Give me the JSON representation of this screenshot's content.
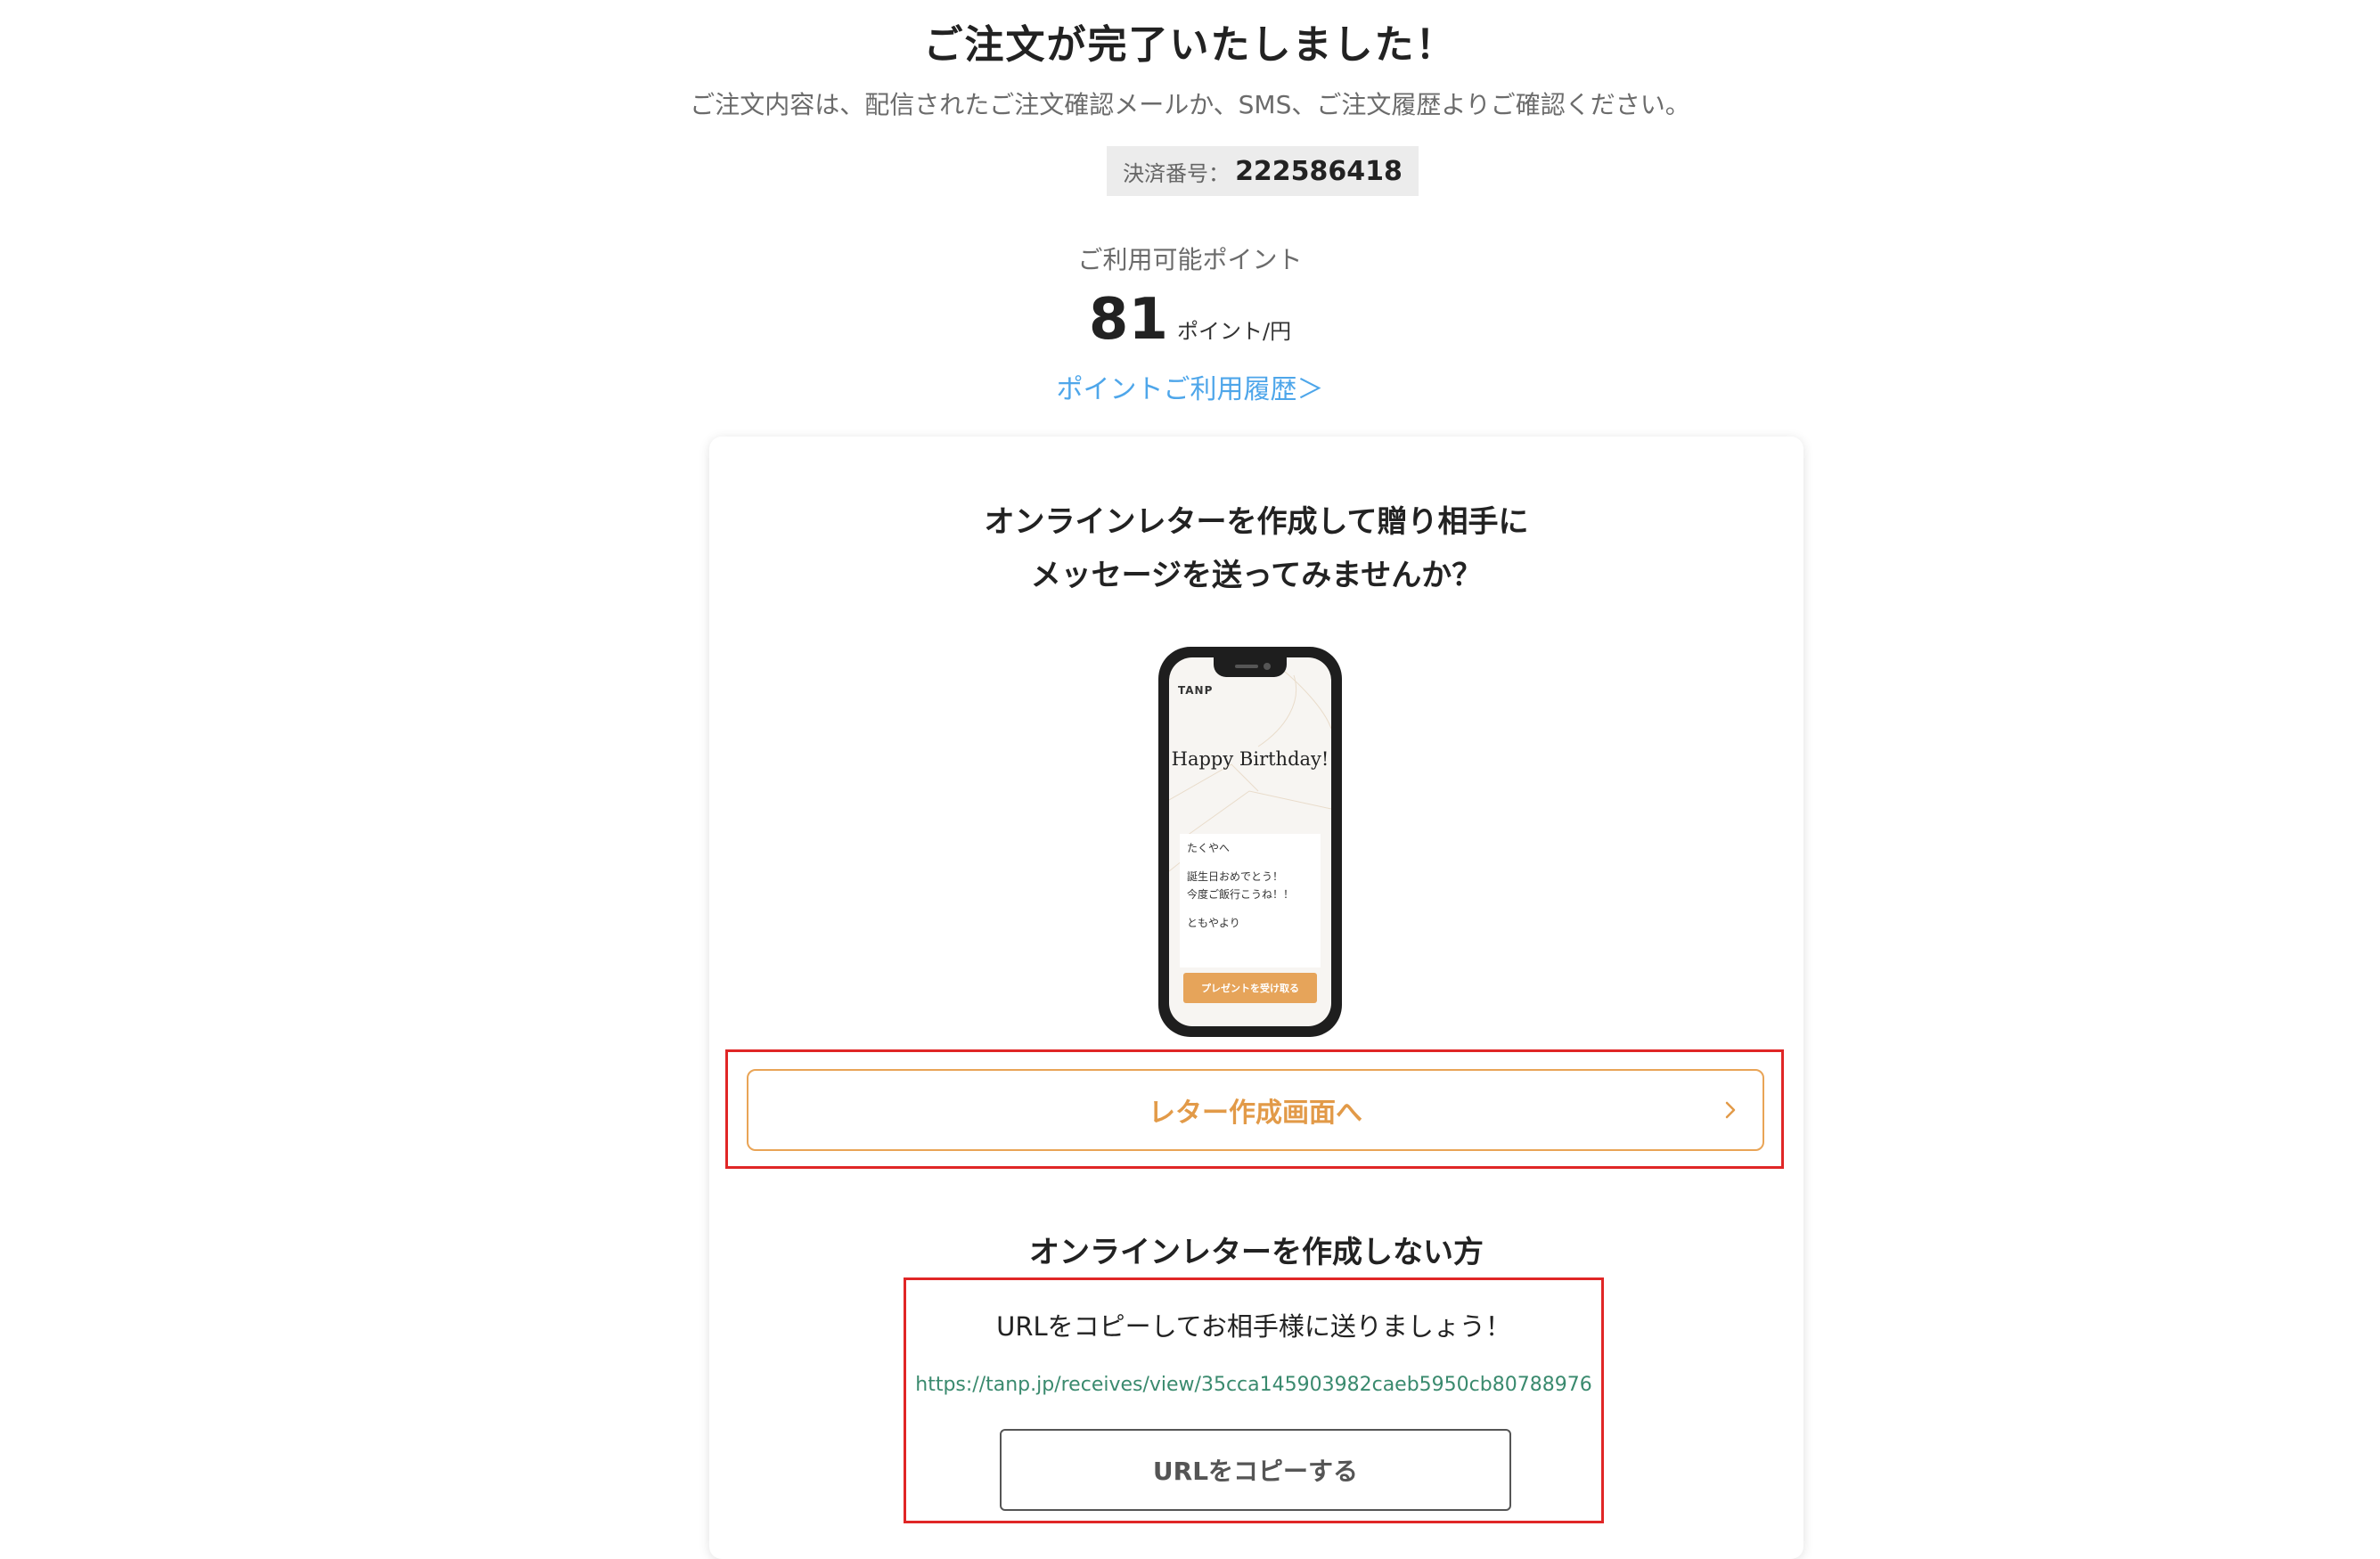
{
  "header": {
    "title": "ご注文が完了いたしました！",
    "subtitle": "ご注文内容は、配信されたご注文確認メールか、SMS、ご注文履歴よりご確認ください。"
  },
  "payment": {
    "label": "決済番号：",
    "number": "222586418"
  },
  "points": {
    "label": "ご利用可能ポイント",
    "value": "81",
    "unit": "ポイント/円",
    "history_link": "ポイントご利用履歴＞"
  },
  "card": {
    "heading_line1": "オンラインレターを作成して贈り相手に",
    "heading_line2": "メッセージを送ってみませんか？",
    "phone": {
      "brand": "TANP",
      "greeting": "Happy Birthday!",
      "message_to": "たくやへ",
      "message_line1": "誕生日おめでとう！",
      "message_line2": "今度ご飯行こうね！！",
      "message_from": "ともやより",
      "button_label": "プレゼントを受け取る"
    },
    "letter_button_label": "レター作成画面へ",
    "no_letter_heading": "オンラインレターを作成しない方",
    "url_prompt": "URLをコピーしてお相手様に送りましょう！",
    "url": "https://tanp.jp/receives/view/35cca145903982caeb5950cb80788976",
    "copy_button_label": "URLをコピーする"
  },
  "colors": {
    "accent_orange": "#e29a48",
    "link_blue": "#4ea6ea",
    "url_green": "#3a8a6e",
    "highlight_red": "#e02626"
  }
}
